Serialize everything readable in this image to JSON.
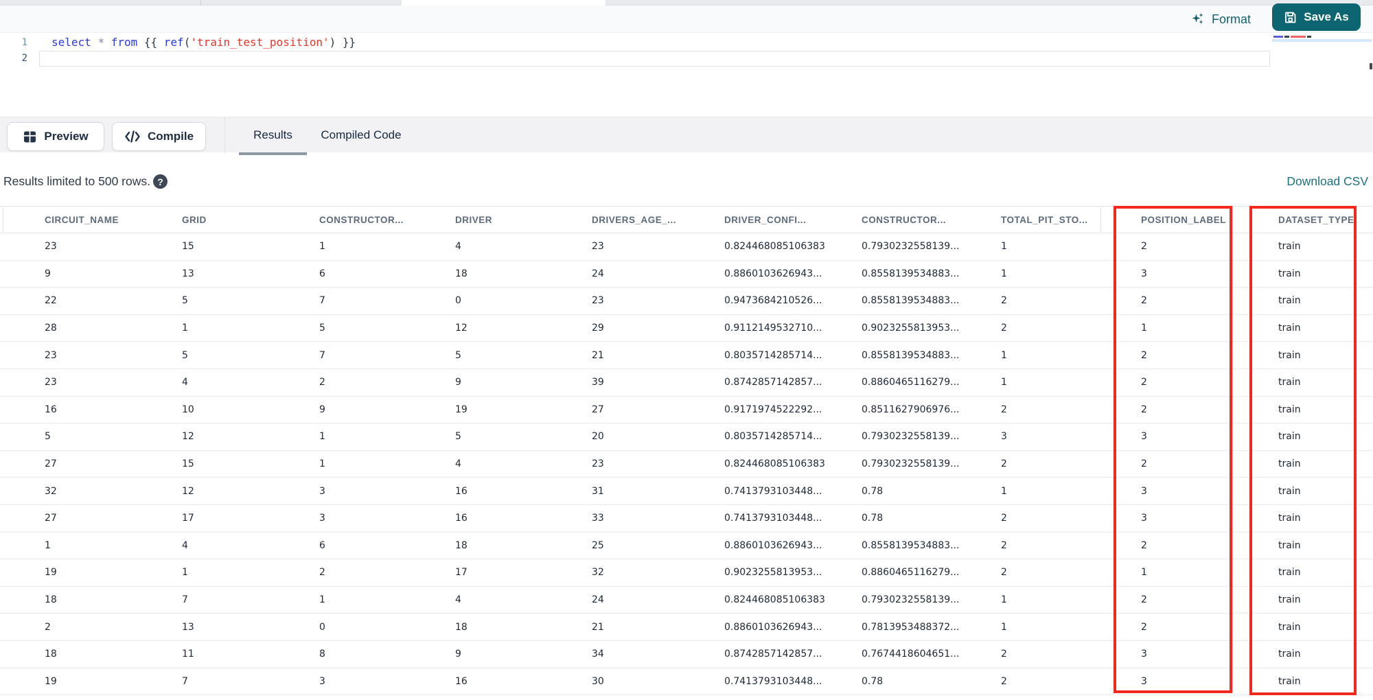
{
  "colors": {
    "accent_teal": "#0c6570",
    "annotation_red": "#f3281d",
    "link_teal": "#1d717f"
  },
  "editor_header": {
    "format_label": "Format",
    "save_as_label": "Save As"
  },
  "editor": {
    "line_numbers": [
      "1",
      "2"
    ],
    "code_tokens": [
      {
        "text": "select",
        "type": "keyword"
      },
      {
        "text": " ",
        "type": "plain"
      },
      {
        "text": "*",
        "type": "operator"
      },
      {
        "text": " ",
        "type": "plain"
      },
      {
        "text": "from",
        "type": "keyword"
      },
      {
        "text": " {{ ",
        "type": "plain"
      },
      {
        "text": "ref",
        "type": "function"
      },
      {
        "text": "(",
        "type": "plain"
      },
      {
        "text": "'train_test_position'",
        "type": "string"
      },
      {
        "text": ") }}",
        "type": "plain"
      }
    ]
  },
  "toolbar": {
    "preview_label": "Preview",
    "compile_label": "Compile",
    "tabs": [
      {
        "label": "Results",
        "active": true
      },
      {
        "label": "Compiled Code",
        "active": false
      }
    ]
  },
  "results_bar": {
    "message": "Results limited to 500 rows.",
    "help_icon": "question-mark",
    "help_glyph": "?",
    "download_label": "Download CSV"
  },
  "table": {
    "columns": [
      "CIRCUIT_NAME",
      "GRID",
      "CONSTRUCTOR...",
      "DRIVER",
      "DRIVERS_AGE_...",
      "DRIVER_CONFI...",
      "CONSTRUCTOR...",
      "TOTAL_PIT_STO...",
      "POSITION_LABEL",
      "DATASET_TYPE"
    ],
    "rows": [
      [
        "23",
        "15",
        "1",
        "4",
        "23",
        "0.824468085106383",
        "0.7930232558139...",
        "1",
        "2",
        "train"
      ],
      [
        "9",
        "13",
        "6",
        "18",
        "24",
        "0.8860103626943...",
        "0.8558139534883...",
        "1",
        "3",
        "train"
      ],
      [
        "22",
        "5",
        "7",
        "0",
        "23",
        "0.9473684210526...",
        "0.8558139534883...",
        "2",
        "2",
        "train"
      ],
      [
        "28",
        "1",
        "5",
        "12",
        "29",
        "0.9112149532710...",
        "0.9023255813953...",
        "2",
        "1",
        "train"
      ],
      [
        "23",
        "5",
        "7",
        "5",
        "21",
        "0.8035714285714...",
        "0.8558139534883...",
        "1",
        "2",
        "train"
      ],
      [
        "23",
        "4",
        "2",
        "9",
        "39",
        "0.8742857142857...",
        "0.8860465116279...",
        "1",
        "2",
        "train"
      ],
      [
        "16",
        "10",
        "9",
        "19",
        "27",
        "0.9171974522292...",
        "0.8511627906976...",
        "2",
        "2",
        "train"
      ],
      [
        "5",
        "12",
        "1",
        "5",
        "20",
        "0.8035714285714...",
        "0.7930232558139...",
        "3",
        "3",
        "train"
      ],
      [
        "27",
        "15",
        "1",
        "4",
        "23",
        "0.824468085106383",
        "0.7930232558139...",
        "2",
        "2",
        "train"
      ],
      [
        "32",
        "12",
        "3",
        "16",
        "31",
        "0.7413793103448...",
        "0.78",
        "1",
        "3",
        "train"
      ],
      [
        "27",
        "17",
        "3",
        "16",
        "33",
        "0.7413793103448...",
        "0.78",
        "2",
        "3",
        "train"
      ],
      [
        "1",
        "4",
        "6",
        "18",
        "25",
        "0.8860103626943...",
        "0.8558139534883...",
        "2",
        "2",
        "train"
      ],
      [
        "19",
        "1",
        "2",
        "17",
        "32",
        "0.9023255813953...",
        "0.8860465116279...",
        "2",
        "1",
        "train"
      ],
      [
        "18",
        "7",
        "1",
        "4",
        "24",
        "0.824468085106383",
        "0.7930232558139...",
        "1",
        "2",
        "train"
      ],
      [
        "2",
        "13",
        "0",
        "18",
        "21",
        "0.8860103626943...",
        "0.7813953488372...",
        "1",
        "2",
        "train"
      ],
      [
        "18",
        "11",
        "8",
        "9",
        "34",
        "0.8742857142857...",
        "0.7674418604651...",
        "2",
        "3",
        "train"
      ],
      [
        "19",
        "7",
        "3",
        "16",
        "30",
        "0.7413793103448...",
        "0.78",
        "2",
        "3",
        "train"
      ]
    ],
    "highlighted_columns": [
      "POSITION_LABEL",
      "DATASET_TYPE"
    ]
  }
}
